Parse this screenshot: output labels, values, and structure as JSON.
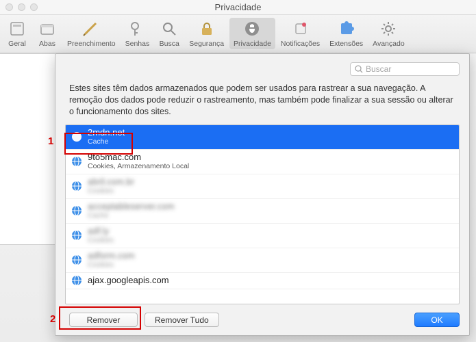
{
  "window": {
    "title": "Privacidade"
  },
  "toolbar": {
    "items": [
      {
        "label": "Geral"
      },
      {
        "label": "Abas"
      },
      {
        "label": "Preenchimento"
      },
      {
        "label": "Senhas"
      },
      {
        "label": "Busca"
      },
      {
        "label": "Segurança"
      },
      {
        "label": "Privacidade",
        "selected": true
      },
      {
        "label": "Notificações"
      },
      {
        "label": "Extensões"
      },
      {
        "label": "Avançado"
      }
    ]
  },
  "sheet": {
    "search_placeholder": "Buscar",
    "description": "Estes sites têm dados armazenados que podem ser usados para rastrear a sua navegação. A remoção dos dados pode reduzir o rastreamento, mas também pode finalizar a sua sessão ou alterar o funcionamento dos sites.",
    "sites": [
      {
        "domain": "2mdn.net",
        "sub": "Cache",
        "selected": true
      },
      {
        "domain": "9to5mac.com",
        "sub": "Cookies, Armazenamento Local"
      },
      {
        "domain": "abril.com.br",
        "sub": "Cookies",
        "blurred": true
      },
      {
        "domain": "acceptableserver.com",
        "sub": "Cache",
        "blurred": true
      },
      {
        "domain": "adf.ly",
        "sub": "Cookies",
        "blurred": true
      },
      {
        "domain": "adform.com",
        "sub": "Cookies",
        "blurred": true
      },
      {
        "domain": "ajax.googleapis.com",
        "sub": "",
        "short": true
      }
    ],
    "remove_label": "Remover",
    "remove_all_label": "Remover Tudo",
    "ok_label": "OK"
  },
  "annotations": {
    "step1": "1",
    "step2": "2"
  }
}
